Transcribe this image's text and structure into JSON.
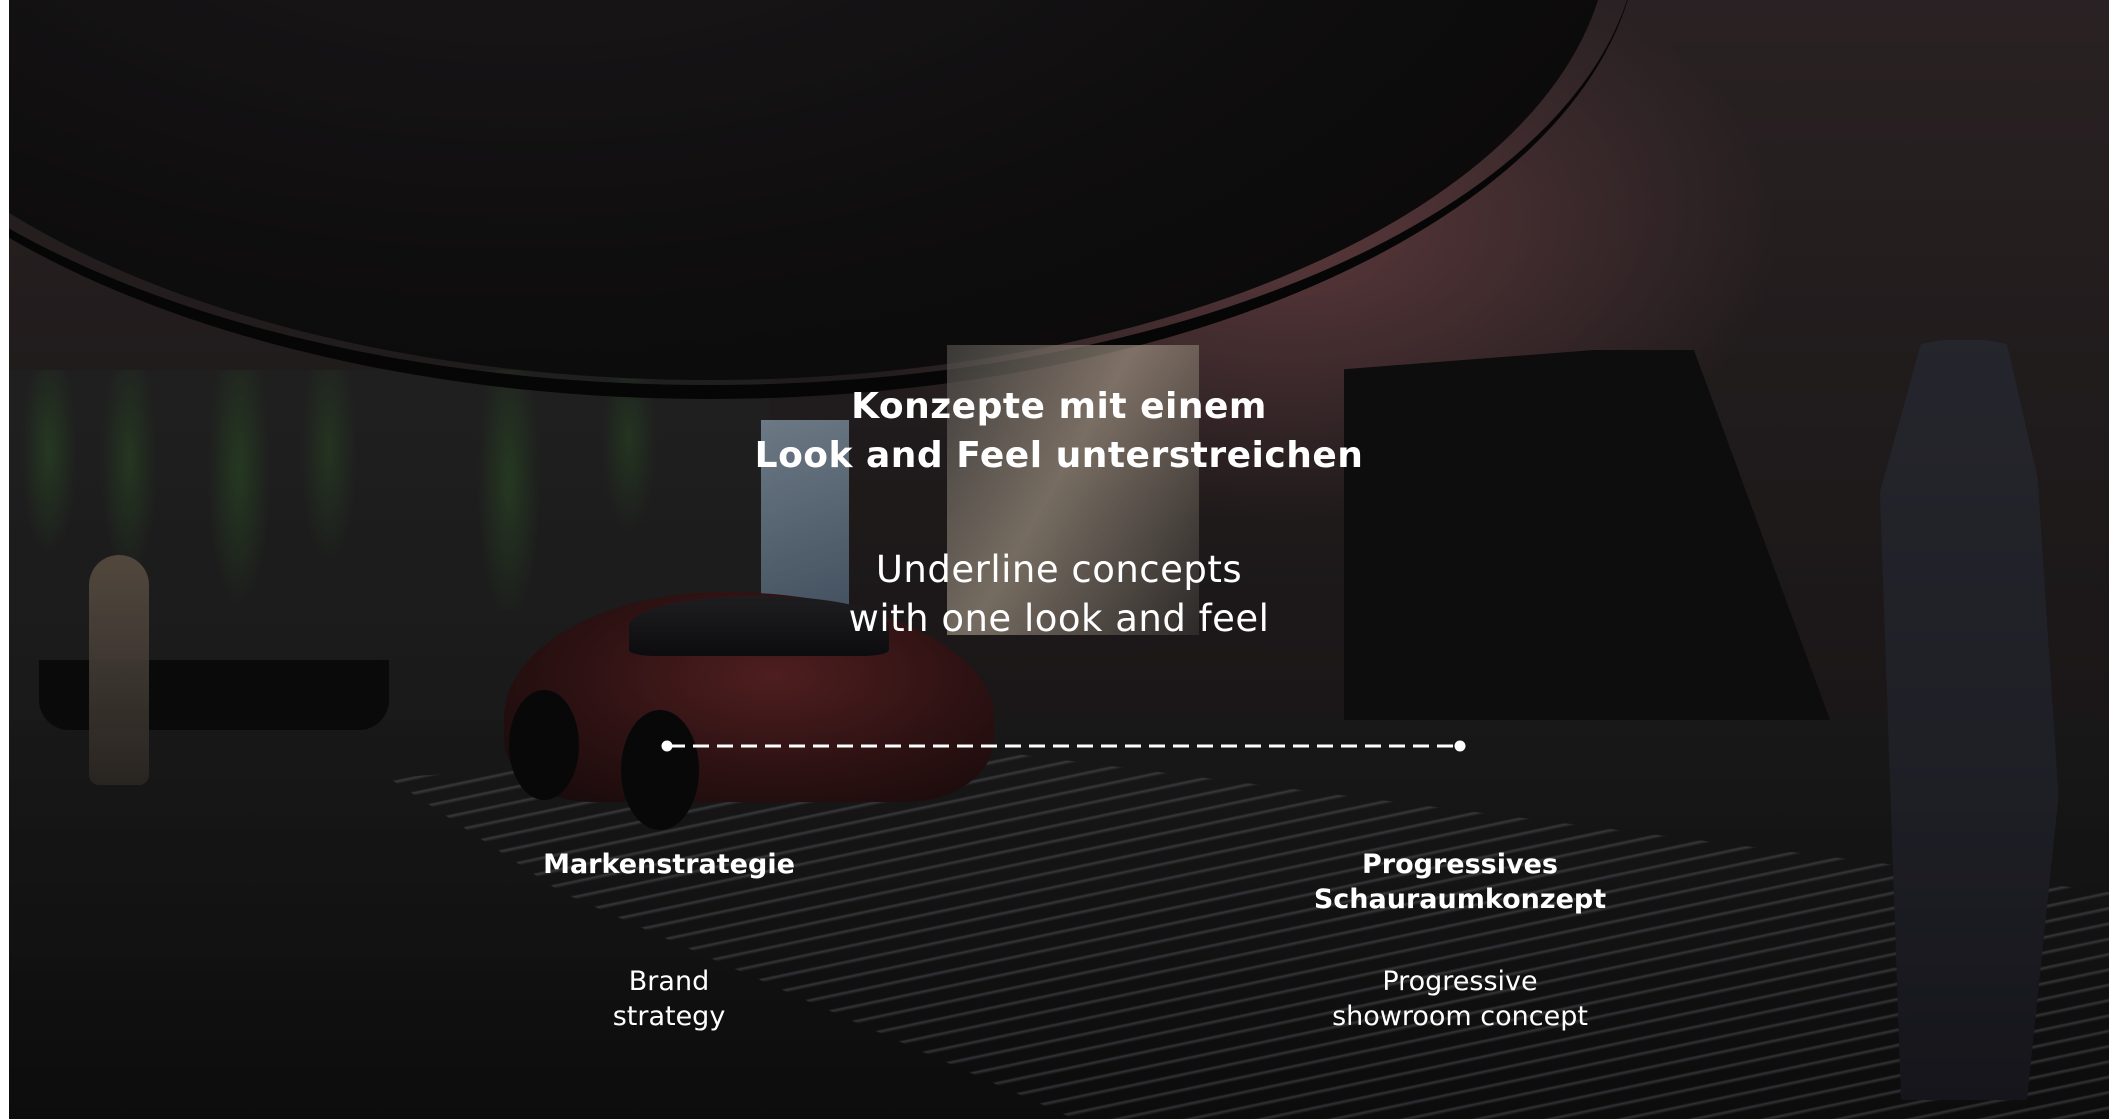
{
  "slide": {
    "heading_de": [
      "Konzepte mit einem",
      "Look and Feel unterstreichen"
    ],
    "heading_en": [
      "Underline concepts",
      "with one look and feel"
    ]
  },
  "timeline": {
    "nodes": [
      {
        "label_de": [
          "Markenstrategie"
        ],
        "label_en": [
          "Brand",
          "strategy"
        ]
      },
      {
        "label_de": [
          "Progressives",
          "Schauraumkonzept"
        ],
        "label_en": [
          "Progressive",
          "showroom concept"
        ]
      }
    ]
  },
  "colors": {
    "text": "#ffffff",
    "line": "#ffffff"
  }
}
